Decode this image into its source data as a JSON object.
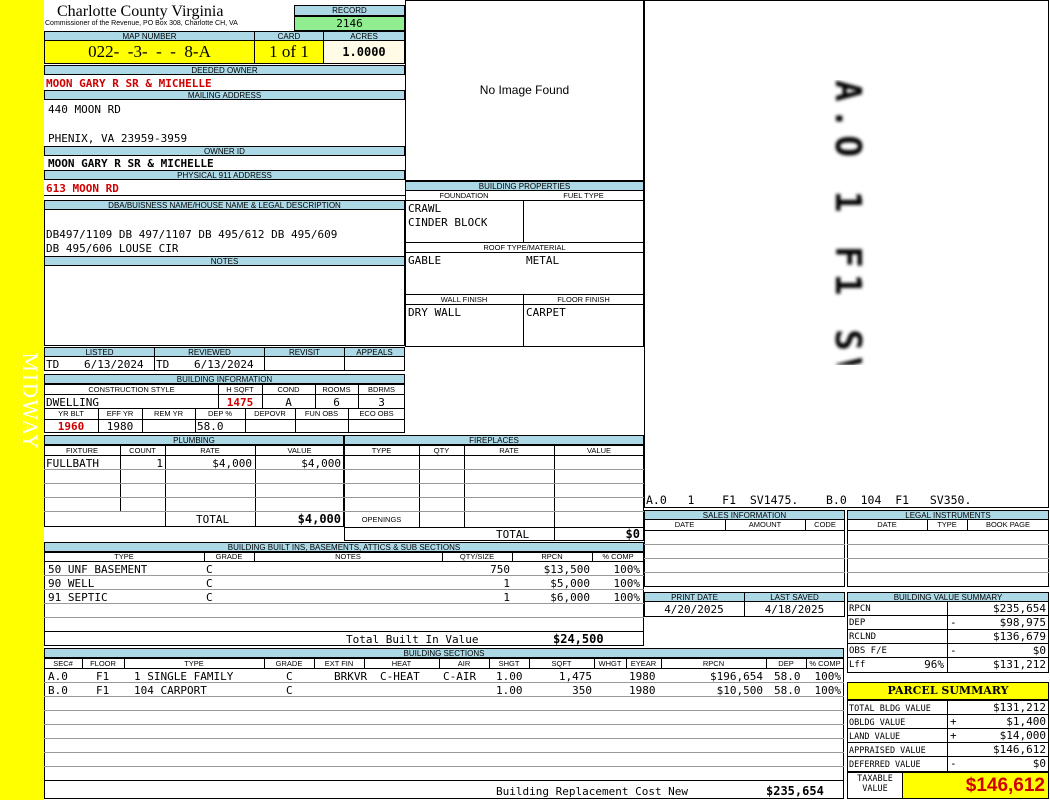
{
  "sidebar": {
    "label": "MIDWAY"
  },
  "header": {
    "county": "Charlotte County Virginia",
    "address_line": "Commissioner of the Revenue, PO Box 308, Charlotte CH, VA",
    "record_label": "RECORD",
    "record_value": "2146"
  },
  "parcel": {
    "map_number_label": "MAP NUMBER",
    "map_number": "022-  -3-  -  -  8-A",
    "card_label": "CARD",
    "card": "1 of 1",
    "acres_label": "ACRES",
    "acres": "1.0000"
  },
  "owner": {
    "deeded_label": "DEEDED OWNER",
    "deeded_owner": "MOON GARY R SR & MICHELLE",
    "mailing_label": "MAILING ADDRESS",
    "mailing_line1": "440 MOON RD",
    "mailing_line2": "PHENIX, VA 23959-3959",
    "owner_id_label": "OWNER ID",
    "owner_id": "MOON GARY R SR & MICHELLE",
    "physical_label": "PHYSICAL 911 ADDRESS",
    "physical_address": "613 MOON RD"
  },
  "legal": {
    "label": "DBA/BUISNESS NAME/HOUSE NAME & LEGAL DESCRIPTION",
    "line1": "DB497/1109 DB 497/1107 DB 495/612 DB 495/609",
    "line2": "DB 495/606 LOUSE CIR",
    "notes_label": "NOTES"
  },
  "photo": {
    "text": "No Image Found"
  },
  "building_properties": {
    "label": "BUILDING PROPERTIES",
    "foundation_label": "FOUNDATION",
    "fuel_label": "FUEL TYPE",
    "foundation_1": "CRAWL",
    "foundation_2": "CINDER BLOCK",
    "roof_label": "ROOF TYPE/MATERIAL",
    "roof_type": "GABLE",
    "roof_material": "METAL",
    "wall_label": "WALL FINISH",
    "floor_label": "FLOOR FINISH",
    "wall": "DRY WALL",
    "floor": "CARPET"
  },
  "sketch": {
    "caption": "A.0   1    F1  SV1475.    B.0  104  F1   SV350.",
    "barcode_text": "A.O 1 F1 SV1475. B.0 104 F1 SV350"
  },
  "listing": {
    "listed_label": "LISTED",
    "reviewed_label": "REVIEWED",
    "revisit_label": "REVISIT",
    "appeals_label": "APPEALS",
    "listed_by": "TD",
    "listed_date": "6/13/2024",
    "reviewed_by": "TD",
    "reviewed_date": "6/13/2024"
  },
  "building_info": {
    "label": "BUILDING INFORMATION",
    "cs_label": "CONSTRUCTION STYLE",
    "hsqft_label": "H SQFT",
    "cond_label": "COND",
    "rooms_label": "ROOMS",
    "bdrms_label": "BDRMS",
    "style": "DWELLING",
    "hsqft": "1475",
    "cond": "A",
    "rooms": "6",
    "bdrms": "3",
    "yrblt_label": "YR BLT",
    "effyr_label": "EFF YR",
    "remyr_label": "REM YR",
    "dep_label": "DEP %",
    "depovr_label": "DEPOVR",
    "funobs_label": "FUN OBS",
    "ecoobs_label": "ECO OBS",
    "yrblt": "1960",
    "effyr": "1980",
    "dep": "58.0"
  },
  "plumbing": {
    "label": "PLUMBING",
    "headers": [
      "FIXTURE",
      "COUNT",
      "RATE",
      "VALUE"
    ],
    "fixture": "FULLBATH",
    "count": "1",
    "rate": "$4,000",
    "value": "$4,000",
    "total_label": "TOTAL",
    "total": "$4,000"
  },
  "fireplaces": {
    "label": "FIREPLACES",
    "headers": [
      "TYPE",
      "QTY",
      "RATE",
      "VALUE"
    ],
    "openings_label": "OPENINGS",
    "total_label": "TOTAL",
    "total": "$0"
  },
  "built_ins": {
    "label": "BUILDING BUILT INS, BASEMENTS, ATTICS & SUB SECTIONS",
    "headers": [
      "TYPE",
      "GRADE",
      "NOTES",
      "QTY/SIZE",
      "RPCN",
      "% COMP"
    ],
    "rows": [
      {
        "type": "50 UNF BASEMENT",
        "grade": "C",
        "qty": "750",
        "rpcn": "$13,500",
        "comp": "100%"
      },
      {
        "type": "90 WELL",
        "grade": "C",
        "qty": "1",
        "rpcn": "$5,000",
        "comp": "100%"
      },
      {
        "type": "91 SEPTIC",
        "grade": "C",
        "qty": "1",
        "rpcn": "$6,000",
        "comp": "100%"
      }
    ],
    "total_label": "Total Built In Value",
    "total": "$24,500"
  },
  "sections": {
    "label": "BUILDING SECTIONS",
    "headers": [
      "SEC#",
      "FLOOR",
      "TYPE",
      "GRADE",
      "EXT FIN",
      "HEAT",
      "AIR",
      "SHGT",
      "SQFT",
      "WHGT",
      "EYEAR",
      "RPCN",
      "DEP",
      "% COMP"
    ],
    "rows": [
      {
        "sec": "A.0",
        "floor": "F1",
        "type": "1 SINGLE FAMILY",
        "grade": "C",
        "ext": "BRKVR",
        "heat": "C-HEAT",
        "air": "C-AIR",
        "shgt": "1.00",
        "sqft": "1,475",
        "eyear": "1980",
        "rpcn": "$196,654",
        "dep": "58.0",
        "comp": "100%"
      },
      {
        "sec": "B.0",
        "floor": "F1",
        "type": "104 CARPORT",
        "grade": "C",
        "ext": "",
        "heat": "",
        "air": "",
        "shgt": "1.00",
        "sqft": "350",
        "eyear": "1980",
        "rpcn": "$10,500",
        "dep": "58.0",
        "comp": "100%"
      }
    ],
    "brcn_label": "Building Replacement Cost New",
    "brcn": "$235,654"
  },
  "sales": {
    "label": "SALES INFORMATION",
    "headers": [
      "DATE",
      "AMOUNT",
      "CODE"
    ]
  },
  "legal_instruments": {
    "label": "LEGAL INSTRUMENTS",
    "headers": [
      "DATE",
      "TYPE",
      "BOOK PAGE"
    ]
  },
  "dates": {
    "print_label": "PRINT DATE",
    "saved_label": "LAST SAVED",
    "print_date": "4/20/2025",
    "last_saved": "4/18/2025"
  },
  "value_summary": {
    "label": "BUILDING VALUE SUMMARY",
    "rows": [
      {
        "k": "RPCN",
        "s": "",
        "v": "$235,654"
      },
      {
        "k": "DEP",
        "s": "-",
        "v": "$98,975"
      },
      {
        "k": "RCLND",
        "s": "",
        "v": "$136,679"
      },
      {
        "k": "OBS F/E",
        "s": "-",
        "v": "$0"
      },
      {
        "k": "Lff",
        "p": "96%",
        "s": "",
        "v": "$131,212"
      }
    ]
  },
  "parcel_summary": {
    "label": "PARCEL SUMMARY",
    "rows": [
      {
        "k": "TOTAL BLDG VALUE",
        "s": "",
        "v": "$131,212"
      },
      {
        "k": "OBLDG VALUE",
        "s": "+",
        "v": "$1,400"
      },
      {
        "k": "LAND VALUE",
        "s": "+",
        "v": "$14,000"
      },
      {
        "k": "APPRAISED VALUE",
        "s": "",
        "v": "$146,612"
      },
      {
        "k": "DEFERRED VALUE",
        "s": "-",
        "v": "$0"
      }
    ],
    "taxable_label_1": "TAXABLE",
    "taxable_label_2": "VALUE",
    "taxable": "$146,612"
  }
}
